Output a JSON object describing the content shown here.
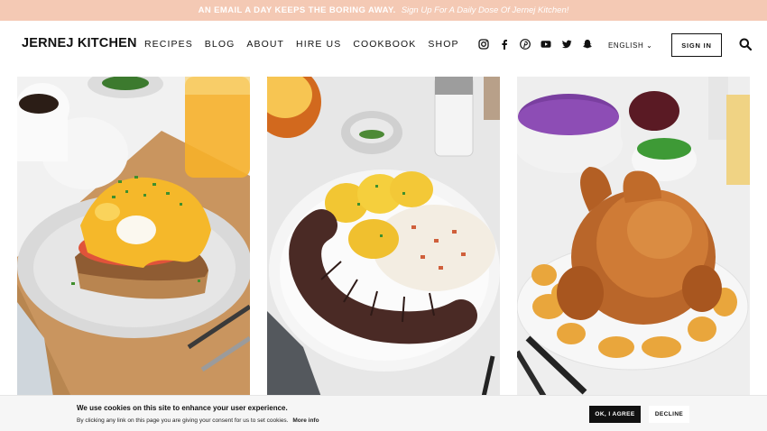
{
  "banner": {
    "headline": "AN EMAIL A DAY KEEPS THE BORING AWAY.",
    "cta": "Sign Up For A Daily Dose Of Jernej Kitchen!",
    "background_color": "#f4c9b4"
  },
  "header": {
    "logo": "JERNEJ KITCHEN",
    "nav": [
      "RECIPES",
      "BLOG",
      "ABOUT",
      "HIRE US",
      "COOKBOOK",
      "SHOP"
    ],
    "social_icons": [
      "instagram-icon",
      "facebook-icon",
      "pinterest-icon",
      "youtube-icon",
      "twitter-icon",
      "snapchat-icon"
    ],
    "language": "ENGLISH",
    "sign_in": "SIGN IN",
    "search_icon": "search-icon"
  },
  "recipes": [
    {
      "image_alt": "Eggs benedict on toast with tomato and hollandaise"
    },
    {
      "image_alt": "Blood sausage with boiled potatoes and sauerkraut"
    },
    {
      "image_alt": "Roast chicken with roasted potatoes"
    }
  ],
  "cookie_bar": {
    "title": "We use cookies on this site to enhance your user experience.",
    "text": "By clicking any link on this page you are giving your consent for us to set cookies.",
    "more_info": "More info",
    "agree": "OK, I AGREE",
    "decline": "DECLINE"
  }
}
